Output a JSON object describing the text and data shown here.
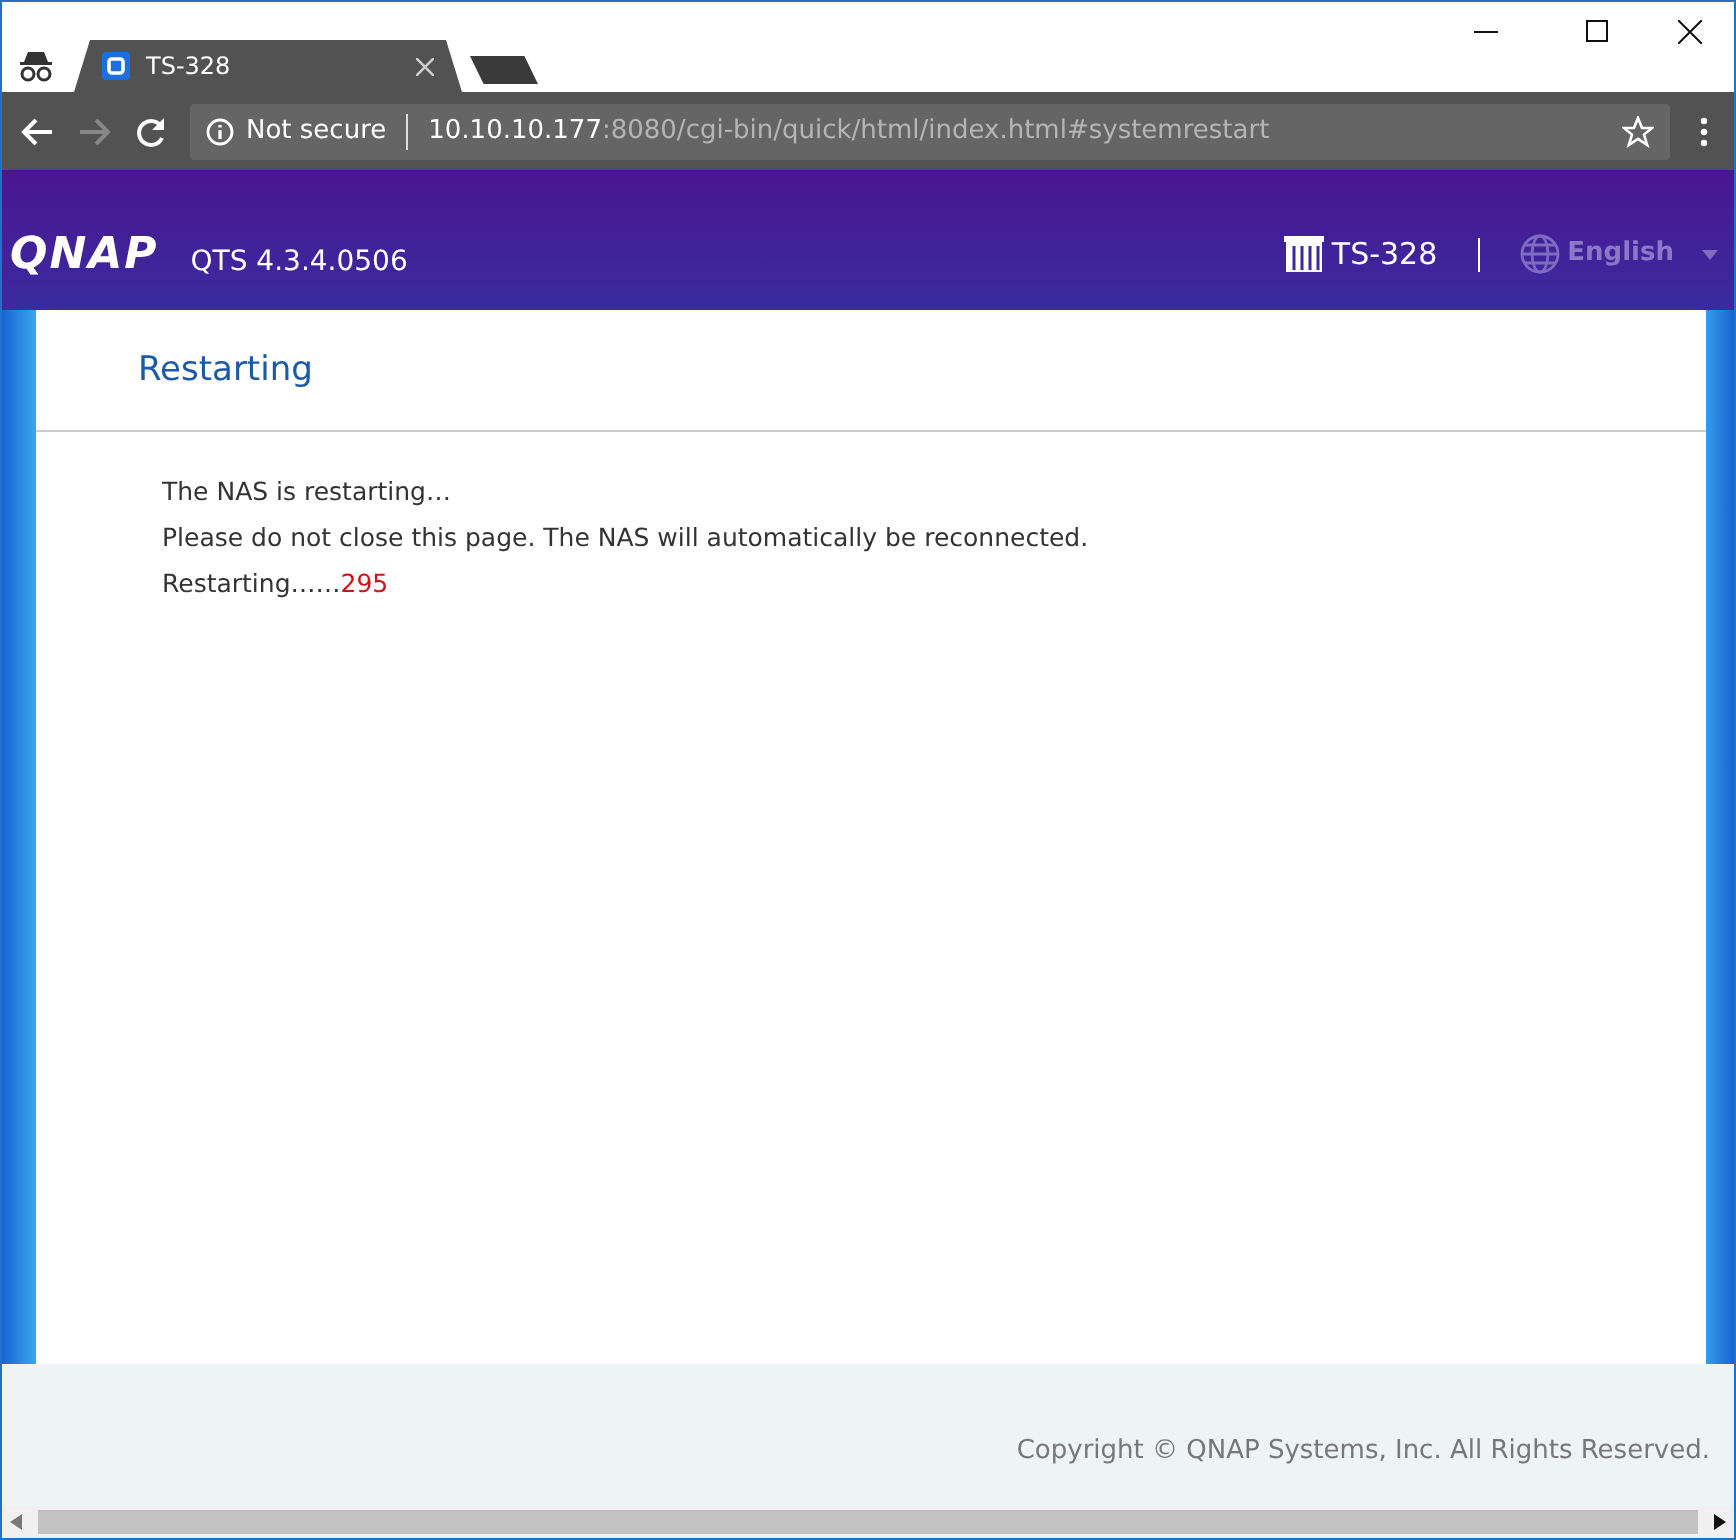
{
  "browser": {
    "incognito": true,
    "tabs": [
      {
        "title": "TS-328",
        "selected": true
      }
    ],
    "security": "Not secure",
    "url": {
      "host": "10.10.10.177",
      "path": ":8080/cgi-bin/quick/html/index.html#systemrestart"
    }
  },
  "header": {
    "logo": "QNAP",
    "version": "QTS 4.3.4.0506",
    "device": "TS-328",
    "language": "English"
  },
  "dialog": {
    "title": "Restarting",
    "lines": [
      "The NAS is restarting…",
      "Please do not close this page. The NAS will automatically be reconnected."
    ],
    "status": {
      "label": "Restarting……",
      "countdown": "295"
    }
  },
  "footer": {
    "copyright": "Copyright © QNAP Systems, Inc. All Rights Reserved."
  }
}
